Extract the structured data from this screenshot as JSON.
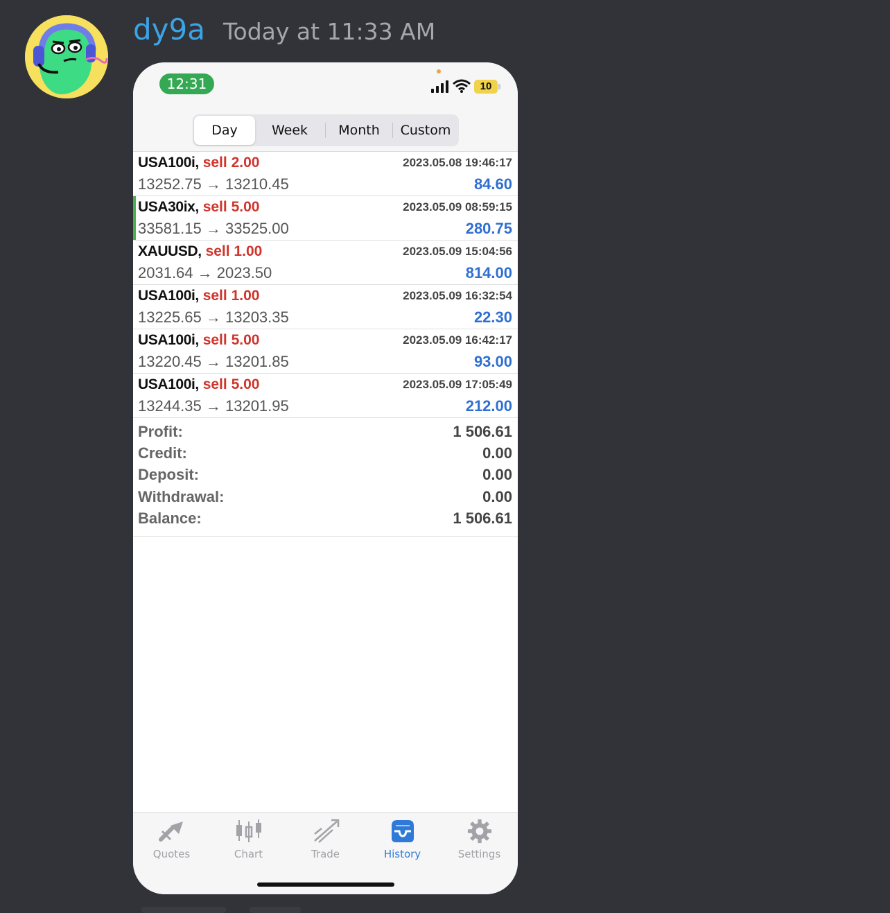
{
  "message": {
    "username": "dy9a",
    "timestamp": "Today at 11:33 AM"
  },
  "status_bar": {
    "time": "12:31",
    "battery": "10"
  },
  "period_tabs": [
    "Day",
    "Week",
    "Month",
    "Custom"
  ],
  "period_selected": "Day",
  "trades": [
    {
      "symbol": "USA100i,",
      "side": "sell 2.00",
      "prices": "13252.75 → 13210.45",
      "time": "2023.05.08 19:46:17",
      "profit": "84.60"
    },
    {
      "symbol": "USA30ix,",
      "side": "sell 5.00",
      "prices": "33581.15 → 33525.00",
      "time": "2023.05.09 08:59:15",
      "profit": "280.75"
    },
    {
      "symbol": "XAUUSD,",
      "side": "sell 1.00",
      "prices": "2031.64 → 2023.50",
      "time": "2023.05.09 15:04:56",
      "profit": "814.00"
    },
    {
      "symbol": "USA100i,",
      "side": "sell 1.00",
      "prices": "13225.65 → 13203.35",
      "time": "2023.05.09 16:32:54",
      "profit": "22.30"
    },
    {
      "symbol": "USA100i,",
      "side": "sell 5.00",
      "prices": "13220.45 → 13201.85",
      "time": "2023.05.09 16:42:17",
      "profit": "93.00"
    },
    {
      "symbol": "USA100i,",
      "side": "sell 5.00",
      "prices": "13244.35 → 13201.95",
      "time": "2023.05.09 17:05:49",
      "profit": "212.00"
    }
  ],
  "summary": [
    {
      "label": "Profit:",
      "value": "1 506.61"
    },
    {
      "label": "Credit:",
      "value": "0.00"
    },
    {
      "label": "Deposit:",
      "value": "0.00"
    },
    {
      "label": "Withdrawal:",
      "value": "0.00"
    },
    {
      "label": "Balance:",
      "value": "1 506.61"
    }
  ],
  "tabbar": [
    {
      "label": "Quotes",
      "icon": "quotes-icon"
    },
    {
      "label": "Chart",
      "icon": "chart-icon"
    },
    {
      "label": "Trade",
      "icon": "trade-icon"
    },
    {
      "label": "History",
      "icon": "history-icon"
    },
    {
      "label": "Settings",
      "icon": "gear-icon"
    }
  ],
  "tab_selected": "History",
  "colors": {
    "background": "#313338",
    "username": "#3ba4e6",
    "sell": "#d0342c",
    "profit": "#2f6fd1",
    "active_tab": "#2f7ad9",
    "clock_pill": "#34a853"
  }
}
